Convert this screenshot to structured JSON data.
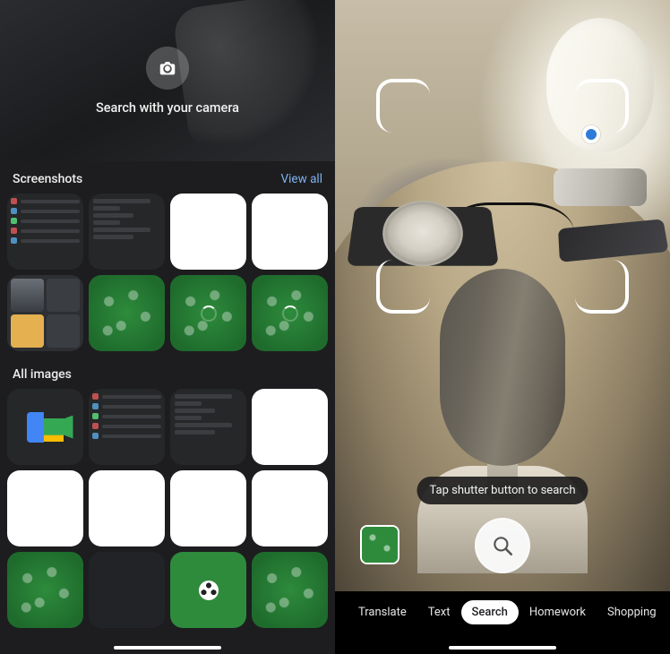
{
  "left": {
    "hero_label": "Search with your camera",
    "screenshots_header": "Screenshots",
    "view_all": "View all",
    "all_images_header": "All images"
  },
  "right": {
    "hint": "Tap shutter button to search",
    "modes": {
      "translate": "Translate",
      "text": "Text",
      "search": "Search",
      "homework": "Homework",
      "shopping": "Shopping"
    }
  }
}
